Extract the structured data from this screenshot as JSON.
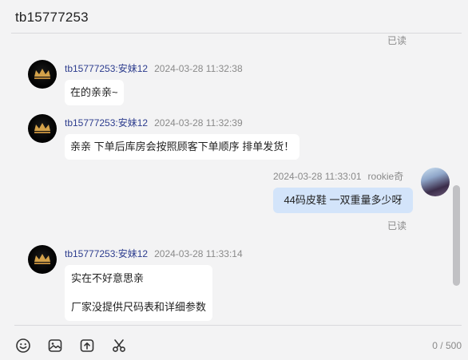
{
  "header": {
    "title": "tb15777253"
  },
  "messages": [
    {
      "read_status": "已读"
    },
    {
      "nick": "tb15777253:安妹12",
      "time": "2024-03-28 11:32:38",
      "text": "在的亲亲~"
    },
    {
      "nick": "tb15777253:安妹12",
      "time": "2024-03-28 11:32:39",
      "text": "亲亲 下单后库房会按照顾客下单顺序 排单发货！"
    },
    {
      "nick": "rookie奇",
      "time": "2024-03-28 11:33:01",
      "text": "44码皮鞋 一双重量多少呀",
      "read_status": "已读"
    },
    {
      "nick": "tb15777253:安妹12",
      "time": "2024-03-28 11:33:14",
      "lines": [
        "实在不好意思亲",
        "厂家没提供尺码表和详细参数"
      ]
    }
  ],
  "toolbar": {
    "icons": [
      "emoji-icon",
      "image-icon",
      "upload-icon",
      "scissors-icon"
    ],
    "counter": "0 / 500"
  }
}
